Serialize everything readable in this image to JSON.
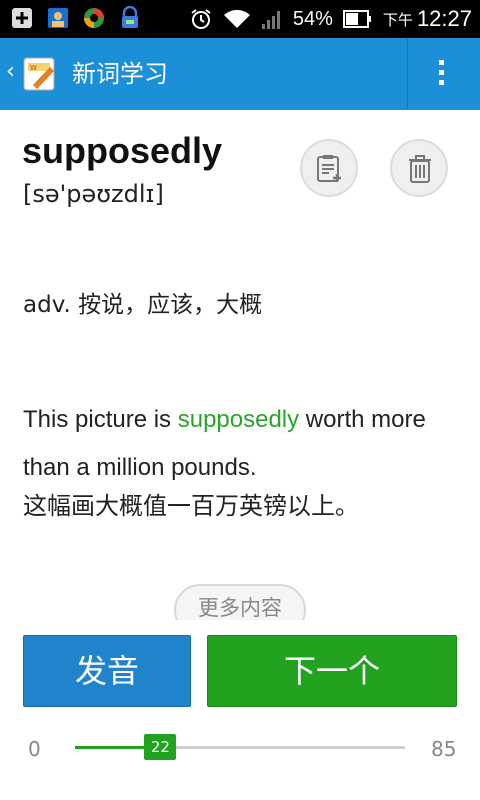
{
  "status_bar": {
    "battery_percent": "54%",
    "ampm": "下午",
    "time": "12:27",
    "icons": [
      "add-icon",
      "contacts-icon",
      "app-sync-icon",
      "notification-lock-icon",
      "alarm-icon",
      "wifi-icon",
      "signal-icon",
      "battery-icon"
    ]
  },
  "action_bar": {
    "title": "新词学习",
    "color": "#1b8fd8"
  },
  "word": {
    "text": "supposedly",
    "phonetic": "[sə'pəʊzdlɪ]"
  },
  "definition": "adv. 按说，应该，大概",
  "example": {
    "before": "This picture is ",
    "highlight": "supposedly",
    "after": " worth more than a million pounds.",
    "translation": "这幅画大概值一百万英镑以上。",
    "highlight_color": "#2aa52a"
  },
  "more_button": "更多内容",
  "buttons": {
    "pronounce": "发音",
    "next": "下一个"
  },
  "progress": {
    "min": "0",
    "max": "85",
    "current": "22"
  }
}
